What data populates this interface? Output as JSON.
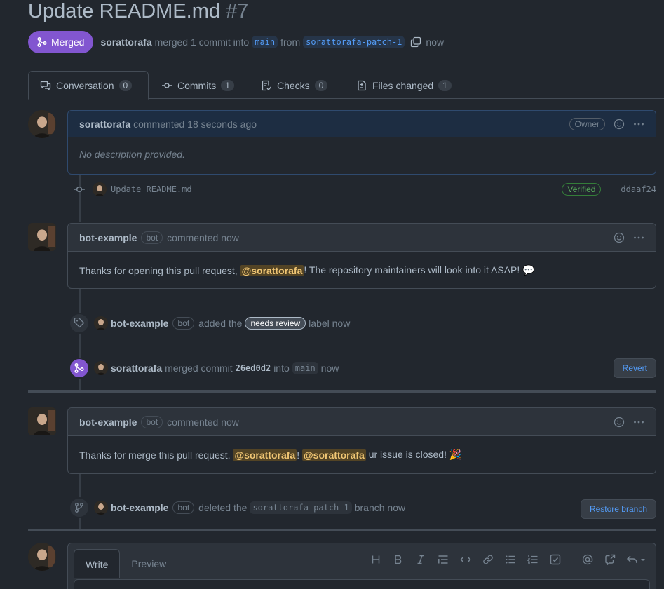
{
  "pr": {
    "title": "Update README.md",
    "number": "#7",
    "state": "Merged",
    "author": "sorattorafa",
    "merge_text": "merged 1 commit into",
    "base_branch": "main",
    "from_text": "from",
    "head_branch": "sorattorafa-patch-1",
    "time": "now"
  },
  "tabs": [
    {
      "label": "Conversation",
      "count": "0"
    },
    {
      "label": "Commits",
      "count": "1"
    },
    {
      "label": "Checks",
      "count": "0"
    },
    {
      "label": "Files changed",
      "count": "1"
    }
  ],
  "comment1": {
    "author": "sorattorafa",
    "action": "commented 18 seconds ago",
    "role": "Owner",
    "body": "No description provided."
  },
  "commit": {
    "message": "Update README.md",
    "verified": "Verified",
    "sha": "ddaaf24"
  },
  "comment2": {
    "author": "bot-example",
    "bot": "bot",
    "action": "commented now",
    "body_pre": "Thanks for opening this pull request,",
    "mention": "@sorattorafa",
    "body_post": "! The repository maintainers will look into it ASAP! 💬"
  },
  "label_event": {
    "actor": "bot-example",
    "bot": "bot",
    "pre": "added the",
    "label": "needs review",
    "post": "label now"
  },
  "merge_event": {
    "actor": "sorattorafa",
    "pre": "merged commit",
    "sha": "26ed0d2",
    "mid": "into",
    "branch": "main",
    "time": "now",
    "button": "Revert"
  },
  "comment3": {
    "author": "bot-example",
    "bot": "bot",
    "action": "commented now",
    "body_pre": "Thanks for merge this pull request,",
    "mention1": "@sorattorafa",
    "sep": "!",
    "mention2": "@sorattorafa",
    "body_post": "ur issue is closed! 🎉"
  },
  "delete_event": {
    "actor": "bot-example",
    "bot": "bot",
    "pre": "deleted the",
    "branch": "sorattorafa-patch-1",
    "post": "branch now",
    "button": "Restore branch"
  },
  "editor": {
    "write": "Write",
    "preview": "Preview"
  },
  "toolbar_icons": [
    "heading-icon",
    "bold-icon",
    "italic-icon",
    "quote-icon",
    "code-icon",
    "link-icon",
    "bulleted-list-icon",
    "numbered-list-icon",
    "task-list-icon",
    "mention-icon",
    "cross-reference-icon",
    "saved-reply-icon"
  ],
  "colors": {
    "background": "#22272e",
    "merged": "#8256d0",
    "accent": "#539bf5",
    "verified": "#57ab5a",
    "mention_bg": "#6f5a1f"
  }
}
